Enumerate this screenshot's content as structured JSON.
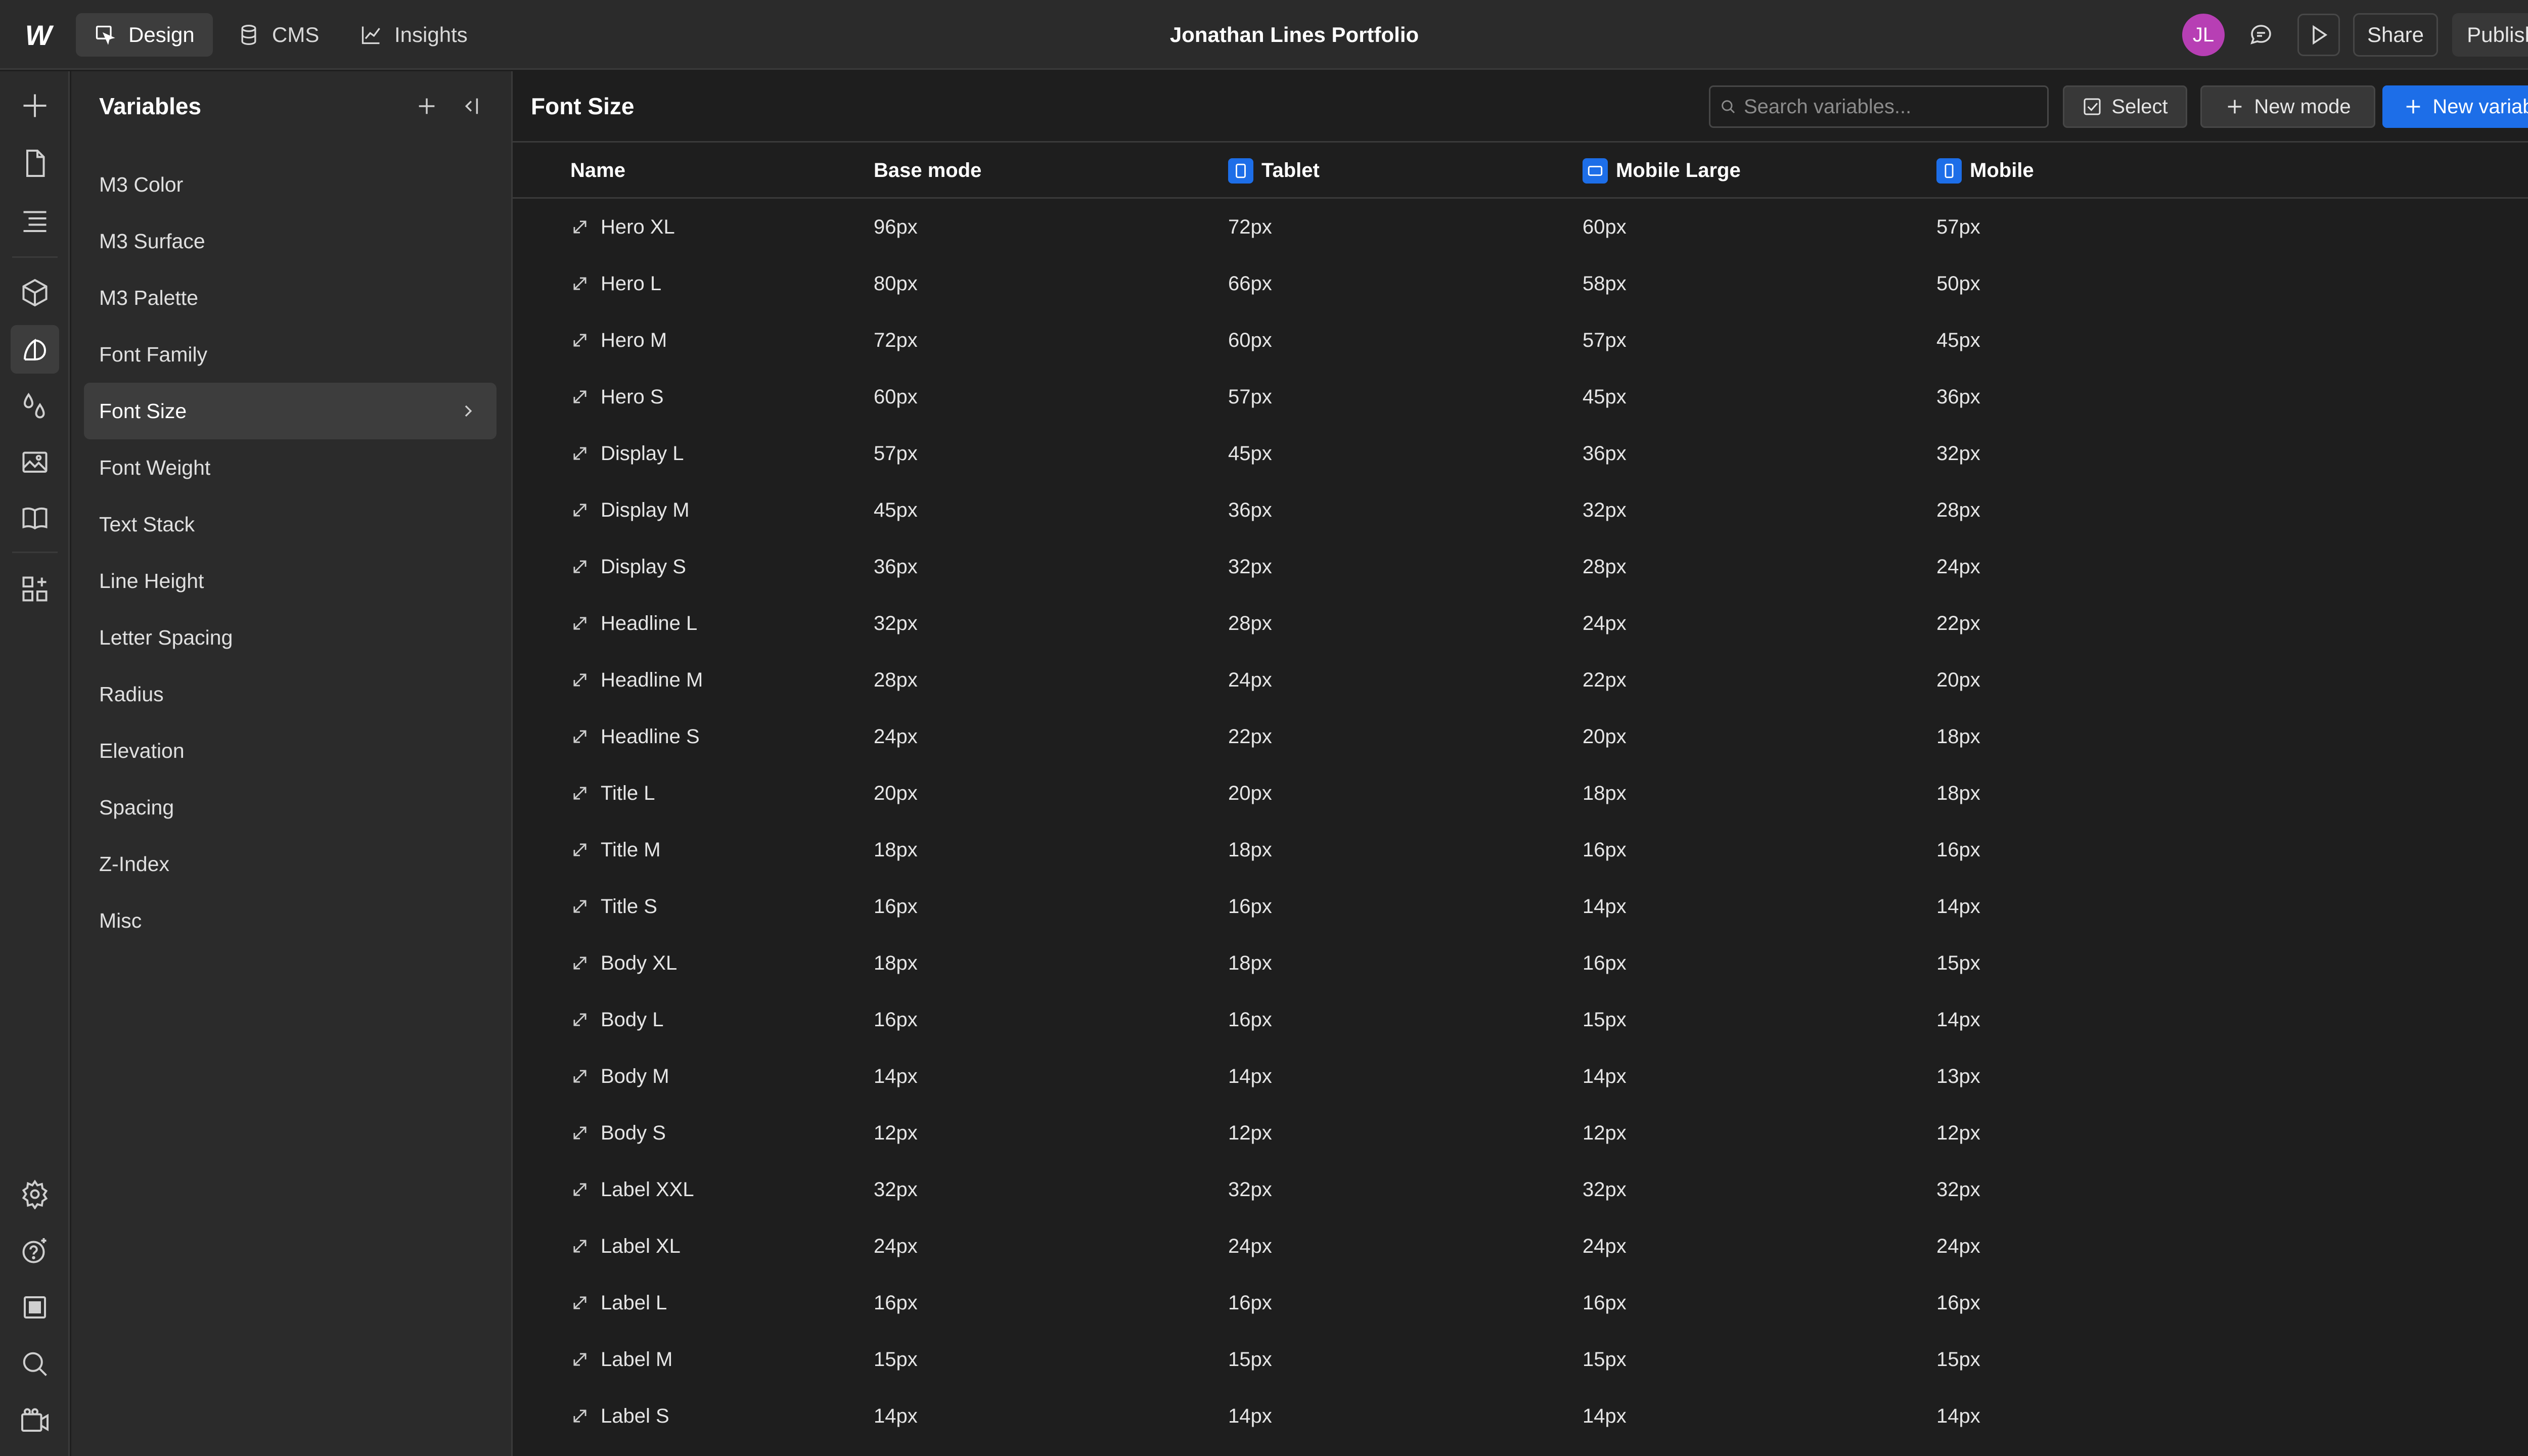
{
  "topbar": {
    "logo": "W",
    "tabs": [
      {
        "label": "Design",
        "icon": "design-icon"
      },
      {
        "label": "CMS",
        "icon": "database-icon"
      },
      {
        "label": "Insights",
        "icon": "chart-icon"
      }
    ],
    "project_title": "Jonathan Lines Portfolio",
    "avatar_initials": "JL",
    "share_label": "Share",
    "publish_label": "Publish"
  },
  "variables_panel": {
    "title": "Variables",
    "collections": [
      "M3 Color",
      "M3 Surface",
      "M3 Palette",
      "Font Family",
      "Font Size",
      "Font Weight",
      "Text Stack",
      "Line Height",
      "Letter Spacing",
      "Radius",
      "Elevation",
      "Spacing",
      "Z-Index",
      "Misc"
    ],
    "active_collection": "Font Size"
  },
  "main": {
    "title": "Font Size",
    "search_placeholder": "Search variables...",
    "select_label": "Select",
    "new_mode_label": "New mode",
    "new_variable_label": "New variable"
  },
  "table": {
    "headers": {
      "name": "Name",
      "base": "Base mode",
      "tablet": "Tablet",
      "mobile_large": "Mobile Large",
      "mobile": "Mobile"
    },
    "rows": [
      {
        "name": "Hero XL",
        "base": "96px",
        "tablet": "72px",
        "mobile_large": "60px",
        "mobile": "57px"
      },
      {
        "name": "Hero L",
        "base": "80px",
        "tablet": "66px",
        "mobile_large": "58px",
        "mobile": "50px"
      },
      {
        "name": "Hero M",
        "base": "72px",
        "tablet": "60px",
        "mobile_large": "57px",
        "mobile": "45px"
      },
      {
        "name": "Hero S",
        "base": "60px",
        "tablet": "57px",
        "mobile_large": "45px",
        "mobile": "36px"
      },
      {
        "name": "Display L",
        "base": "57px",
        "tablet": "45px",
        "mobile_large": "36px",
        "mobile": "32px"
      },
      {
        "name": "Display M",
        "base": "45px",
        "tablet": "36px",
        "mobile_large": "32px",
        "mobile": "28px"
      },
      {
        "name": "Display S",
        "base": "36px",
        "tablet": "32px",
        "mobile_large": "28px",
        "mobile": "24px"
      },
      {
        "name": "Headline L",
        "base": "32px",
        "tablet": "28px",
        "mobile_large": "24px",
        "mobile": "22px"
      },
      {
        "name": "Headline M",
        "base": "28px",
        "tablet": "24px",
        "mobile_large": "22px",
        "mobile": "20px"
      },
      {
        "name": "Headline S",
        "base": "24px",
        "tablet": "22px",
        "mobile_large": "20px",
        "mobile": "18px"
      },
      {
        "name": "Title L",
        "base": "20px",
        "tablet": "20px",
        "mobile_large": "18px",
        "mobile": "18px"
      },
      {
        "name": "Title M",
        "base": "18px",
        "tablet": "18px",
        "mobile_large": "16px",
        "mobile": "16px"
      },
      {
        "name": "Title S",
        "base": "16px",
        "tablet": "16px",
        "mobile_large": "14px",
        "mobile": "14px"
      },
      {
        "name": "Body XL",
        "base": "18px",
        "tablet": "18px",
        "mobile_large": "16px",
        "mobile": "15px"
      },
      {
        "name": "Body L",
        "base": "16px",
        "tablet": "16px",
        "mobile_large": "15px",
        "mobile": "14px"
      },
      {
        "name": "Body M",
        "base": "14px",
        "tablet": "14px",
        "mobile_large": "14px",
        "mobile": "13px"
      },
      {
        "name": "Body S",
        "base": "12px",
        "tablet": "12px",
        "mobile_large": "12px",
        "mobile": "12px"
      },
      {
        "name": "Label XXL",
        "base": "32px",
        "tablet": "32px",
        "mobile_large": "32px",
        "mobile": "32px"
      },
      {
        "name": "Label XL",
        "base": "24px",
        "tablet": "24px",
        "mobile_large": "24px",
        "mobile": "24px"
      },
      {
        "name": "Label L",
        "base": "16px",
        "tablet": "16px",
        "mobile_large": "16px",
        "mobile": "16px"
      },
      {
        "name": "Label M",
        "base": "15px",
        "tablet": "15px",
        "mobile_large": "15px",
        "mobile": "15px"
      },
      {
        "name": "Label S",
        "base": "14px",
        "tablet": "14px",
        "mobile_large": "14px",
        "mobile": "14px"
      }
    ]
  },
  "colors": {
    "accent": "#1d6ee8",
    "avatar": "#b73fb4",
    "background": "#1e1e1e",
    "panel": "#2b2b2b"
  }
}
